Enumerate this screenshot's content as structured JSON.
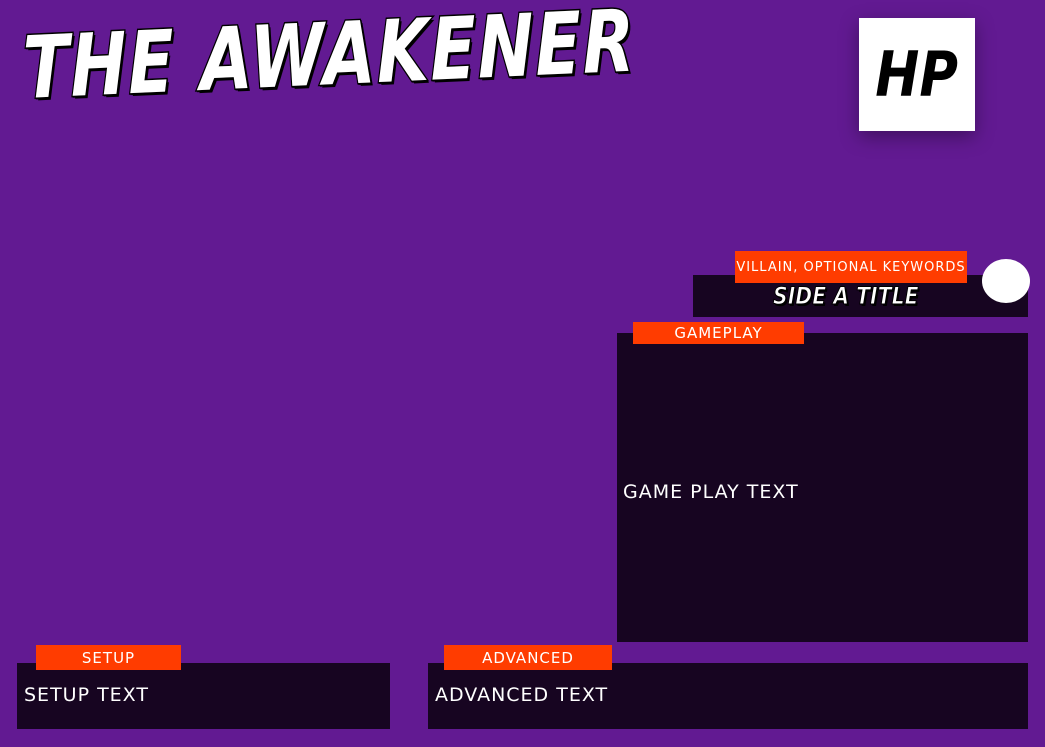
{
  "card": {
    "title": "The Awakener",
    "hp_label": "HP"
  },
  "side_a": {
    "keywords": "Villain, Optional Keywords",
    "title": "Side A Title"
  },
  "gameplay": {
    "label": "Gameplay",
    "text": "Game Play Text"
  },
  "setup": {
    "label": "Setup",
    "text": "Setup Text"
  },
  "advanced": {
    "label": "Advanced",
    "text": "Advanced Text"
  },
  "colors": {
    "background": "#621a92",
    "panel": "#170521",
    "tag": "#ff3c00",
    "hp_box": "#ffffff"
  }
}
